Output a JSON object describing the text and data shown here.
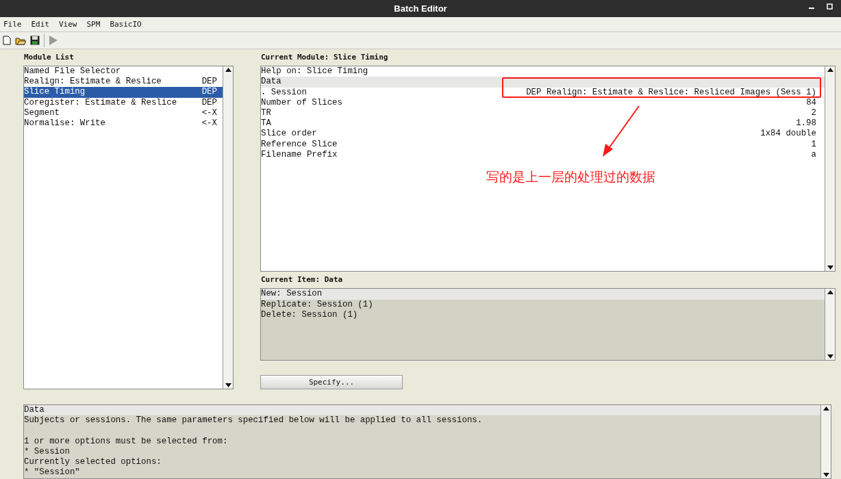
{
  "window": {
    "title": "Batch Editor"
  },
  "menu": [
    "File",
    "Edit",
    "View",
    "SPM",
    "BasicIO"
  ],
  "module_list": {
    "label": "Module List",
    "items": [
      {
        "name": "Named File Selector",
        "selected": false
      },
      {
        "name": "Realign: Estimate & Reslice",
        "status": "DEP",
        "selected": false
      },
      {
        "name": "Slice Timing",
        "status": "DEP",
        "selected": true
      },
      {
        "name": "Coregister: Estimate & Reslice",
        "status": "DEP",
        "selected": false
      },
      {
        "name": "Segment",
        "status": "<-X",
        "selected": false
      },
      {
        "name": "Normalise: Write",
        "status": "<-X",
        "selected": false
      }
    ]
  },
  "current_module": {
    "label": "Current Module: Slice Timing",
    "rows": [
      {
        "label": "Help on: Slice Timing",
        "selected": false
      },
      {
        "label": "Data",
        "selected": true
      },
      {
        "label": ". Session",
        "value": "DEP Realign: Estimate & Reslice: Resliced Images (Sess 1)",
        "selected": false
      },
      {
        "label": "Number of Slices",
        "value": "84",
        "selected": false
      },
      {
        "label": "TR",
        "value": "2",
        "selected": false
      },
      {
        "label": "TA",
        "value": "1.98",
        "selected": false
      },
      {
        "label": "Slice order",
        "value": "1x84 double",
        "selected": false
      },
      {
        "label": "Reference Slice",
        "value": "1",
        "selected": false
      },
      {
        "label": "Filename Prefix",
        "value": "a",
        "selected": false
      }
    ]
  },
  "current_item": {
    "label": "Current Item: Data",
    "items": [
      {
        "text": "New: Session",
        "selected": true
      },
      {
        "text": "Replicate: Session (1)",
        "selected": false
      },
      {
        "text": "Delete: Session (1)",
        "selected": false
      }
    ]
  },
  "specify_button": "Specify...",
  "help": {
    "paragraphs": [
      {
        "lines": [
          {
            "text": "Data",
            "selected": true
          },
          {
            "text": "Subjects or sessions. The same parameters specified below will be applied to all sessions.",
            "selected": false
          }
        ]
      },
      {
        "lines": [
          {
            "text": "1 or more options must be selected from:",
            "selected": false
          },
          {
            "text": "* Session",
            "selected": false
          },
          {
            "text": "Currently selected options:",
            "selected": false
          },
          {
            "text": "* \"Session\"",
            "selected": false
          }
        ]
      }
    ]
  },
  "annotation": {
    "note": "写的是上一层的处理过的数据"
  }
}
